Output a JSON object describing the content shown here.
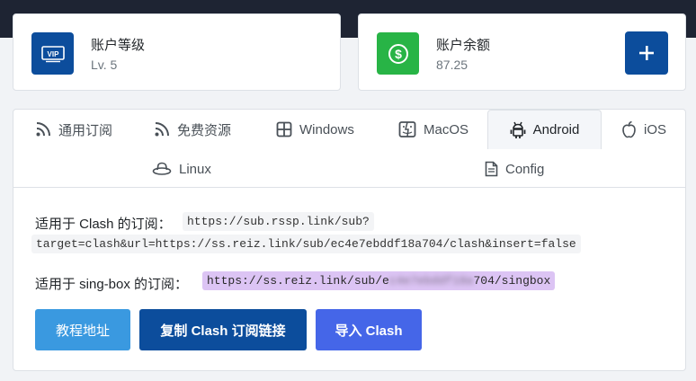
{
  "account": {
    "level_title": "账户等级",
    "level_value": "Lv. 5",
    "balance_title": "账户余额",
    "balance_value": "87.25",
    "vip_badge": "VIP",
    "add_icon": "plus-icon"
  },
  "tabs": [
    {
      "label": "通用订阅",
      "icon": "rss-icon"
    },
    {
      "label": "免费资源",
      "icon": "rss-icon"
    },
    {
      "label": "Windows",
      "icon": "windows-icon"
    },
    {
      "label": "MacOS",
      "icon": "finder-icon"
    },
    {
      "label": "Android",
      "icon": "android-icon",
      "active": true
    },
    {
      "label": "iOS",
      "icon": "apple-icon"
    },
    {
      "label": "Linux",
      "icon": "redhat-icon"
    },
    {
      "label": "Config",
      "icon": "file-icon"
    }
  ],
  "content": {
    "clash_label": "适用于 Clash 的订阅：",
    "clash_url_line1": "https://sub.rssp.link/sub?",
    "clash_url_line2": "target=clash&url=https://ss.reiz.link/sub/ec4e7ebddf18a704/clash&insert=false",
    "singbox_label": "适用于 sing-box 的订阅：",
    "singbox_url_prefix": "https://ss.reiz.link/sub/e",
    "singbox_url_suffix": "704/singbox"
  },
  "buttons": {
    "tutorial": "教程地址",
    "copy_clash": "复制 Clash 订阅链接",
    "import_clash": "导入 Clash"
  },
  "colors": {
    "primary": "#0c4d9c",
    "success": "#28b446",
    "info": "#3a99e0",
    "indigo": "#4566e8",
    "highlight": "#dcc4f4"
  }
}
